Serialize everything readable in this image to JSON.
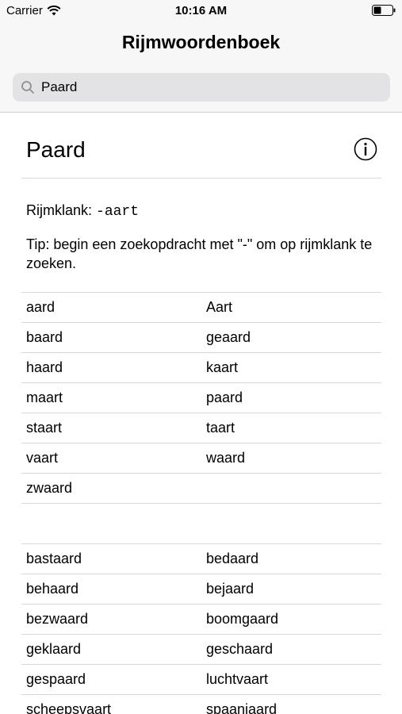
{
  "status_bar": {
    "carrier": "Carrier",
    "time": "10:16 AM",
    "wifi_icon": "wifi-icon",
    "battery_icon": "battery-icon"
  },
  "nav": {
    "title": "Rijmwoordenboek"
  },
  "search": {
    "value": "Paard",
    "icon": "search-icon"
  },
  "word": {
    "title": "Paard",
    "info_icon": "info-icon"
  },
  "rhyme": {
    "label": "Rijmklank:",
    "value": "-aart"
  },
  "tip": "Tip: begin een zoekopdracht met \"-\" om op rijmklank te zoeken.",
  "group1": [
    [
      "aard",
      "Aart"
    ],
    [
      "baard",
      "geaard"
    ],
    [
      "haard",
      "kaart"
    ],
    [
      "maart",
      "paard"
    ],
    [
      "staart",
      "taart"
    ],
    [
      "vaart",
      "waard"
    ],
    [
      "zwaard",
      ""
    ]
  ],
  "group2": [
    [
      "bastaard",
      "bedaard"
    ],
    [
      "behaard",
      "bejaard"
    ],
    [
      "bezwaard",
      "boomgaard"
    ],
    [
      "geklaard",
      "geschaard"
    ],
    [
      "gespaard",
      "luchtvaart"
    ],
    [
      "scheepsvaart",
      "spaanjaard"
    ]
  ]
}
